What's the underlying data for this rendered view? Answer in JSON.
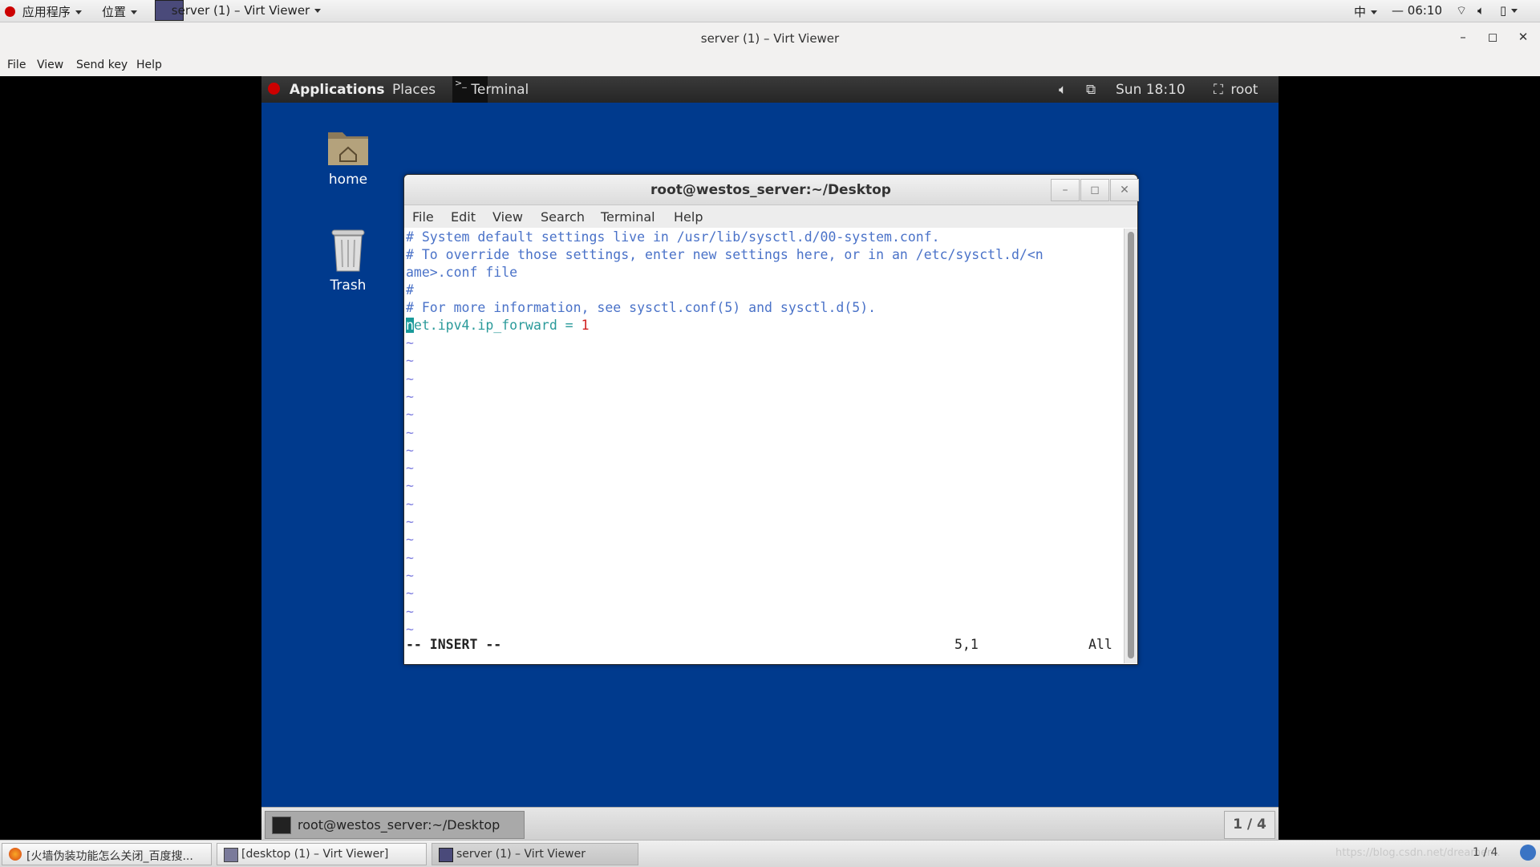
{
  "host_panel": {
    "apps": "应用程序",
    "places": "位置",
    "window_title": "server (1) – Virt Viewer",
    "input_method": "中",
    "clock": "06:10"
  },
  "viewer": {
    "title": "server (1) – Virt Viewer",
    "menu": [
      "File",
      "View",
      "Send key",
      "Help"
    ],
    "controls": [
      "–",
      "◻",
      "✕"
    ]
  },
  "guest_panel": {
    "applications": "Applications",
    "places": "Places",
    "terminal_tab": "Terminal",
    "clock": "Sun 18:10",
    "user": "root"
  },
  "desktop_icons": [
    {
      "label": "home"
    },
    {
      "label": "Trash"
    }
  ],
  "terminal": {
    "title": "root@westos_server:~/Desktop",
    "menu": [
      "File",
      "Edit",
      "View",
      "Search",
      "Terminal",
      "Help"
    ],
    "lines": [
      "# System default settings live in /usr/lib/sysctl.d/00-system.conf.",
      "# To override those settings, enter new settings here, or in an /etc/sysctl.d/<n",
      "ame>.conf file",
      "#",
      "# For more information, see sysctl.conf(5) and sysctl.d(5)."
    ],
    "setting": {
      "cursor_char": "n",
      "key": "et.ipv4.ip_forward",
      "eq": " = ",
      "value": "1"
    },
    "tilde": "~",
    "status_mode": "-- INSERT --",
    "status_pos": "5,1",
    "status_scroll": "All"
  },
  "guest_bottom": {
    "task_label": "root@westos_server:~/Desktop",
    "workspace": "1 / 4"
  },
  "host_taskbar": {
    "items": [
      "[火墙伪装功能怎么关闭_百度搜...",
      "[desktop (1) – Virt Viewer]",
      "server (1) – Virt Viewer"
    ],
    "watermark": "https://blog.csdn.net/dreamer...",
    "workspace": "1 / 4"
  }
}
